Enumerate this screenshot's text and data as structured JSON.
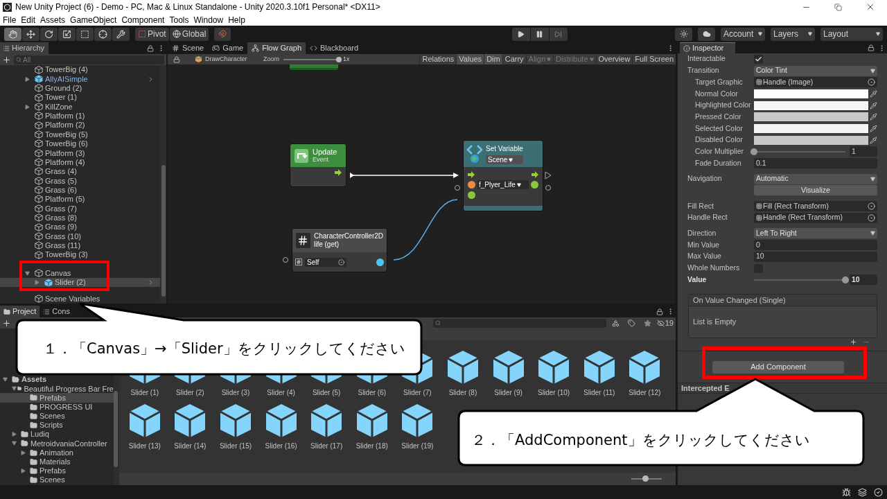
{
  "window": {
    "title": "New Unity Project (6) - Demo - PC, Mac & Linux Standalone - Unity 2020.3.10f1 Personal* <DX11>",
    "menu": [
      "File",
      "Edit",
      "Assets",
      "GameObject",
      "Component",
      "Tools",
      "Window",
      "Help"
    ]
  },
  "toolbar": {
    "tools": [
      {
        "kind": "hand",
        "selected": true
      },
      {
        "kind": "move",
        "selected": false
      },
      {
        "kind": "rotate",
        "selected": false
      },
      {
        "kind": "scale",
        "selected": false
      },
      {
        "kind": "rect",
        "selected": false
      },
      {
        "kind": "transform",
        "selected": false
      },
      {
        "kind": "custom",
        "selected": false
      }
    ],
    "pivot": "Pivot",
    "space": "Global",
    "account": "Account",
    "layers": "Layers",
    "layout": "Layout"
  },
  "hierarchy": {
    "title": "Hierarchy",
    "placeholder": "All",
    "items": [
      {
        "label": "TowerBig (4)",
        "prefab": false,
        "selected": false
      },
      {
        "label": "AllyAISimple",
        "prefab": true,
        "selected": false,
        "expanded": false
      },
      {
        "label": "Ground (2)",
        "prefab": false,
        "selected": false
      },
      {
        "label": "Tower (1)",
        "prefab": false,
        "selected": false
      },
      {
        "label": "KillZone",
        "prefab": false,
        "selected": false,
        "expanded": false
      },
      {
        "label": "Platform (1)",
        "prefab": false,
        "selected": false
      },
      {
        "label": "Platform (2)",
        "prefab": false,
        "selected": false
      },
      {
        "label": "TowerBig (5)",
        "prefab": false,
        "selected": false
      },
      {
        "label": "TowerBig (6)",
        "prefab": false,
        "selected": false
      },
      {
        "label": "Platform (3)",
        "prefab": false,
        "selected": false
      },
      {
        "label": "Platform (4)",
        "prefab": false,
        "selected": false
      },
      {
        "label": "Grass (4)",
        "prefab": false,
        "selected": false
      },
      {
        "label": "Grass (5)",
        "prefab": false,
        "selected": false
      },
      {
        "label": "Grass (6)",
        "prefab": false,
        "selected": false
      },
      {
        "label": "Platform (5)",
        "prefab": false,
        "selected": false
      },
      {
        "label": "Grass (7)",
        "prefab": false,
        "selected": false
      },
      {
        "label": "Grass (8)",
        "prefab": false,
        "selected": false
      },
      {
        "label": "Grass (9)",
        "prefab": false,
        "selected": false
      },
      {
        "label": "Grass (10)",
        "prefab": false,
        "selected": false
      },
      {
        "label": "Grass (11)",
        "prefab": false,
        "selected": false
      },
      {
        "label": "TowerBig (3)",
        "prefab": false,
        "selected": false
      },
      {
        "label": "Canvas",
        "prefab": false,
        "selected": false,
        "expanded": true,
        "children": [
          {
            "label": "Slider (2)",
            "prefab": true,
            "selected": true,
            "expanded": false
          }
        ]
      },
      {
        "label": "Scene Variables",
        "prefab": false,
        "selected": false
      }
    ]
  },
  "graph": {
    "tabs": [
      {
        "label": "Scene",
        "kind": "scene",
        "selected": false
      },
      {
        "label": "Game",
        "kind": "game",
        "selected": false
      },
      {
        "label": "Flow Graph",
        "kind": "flow",
        "selected": true
      },
      {
        "label": "Blackboard",
        "kind": "code",
        "selected": false
      }
    ],
    "asset": "DrawCharacter",
    "zoom_label": "Zoom",
    "zoom": {
      "level": 1
    },
    "zoom_value": "1x",
    "buttons": [
      {
        "label": "Relations",
        "selected": false,
        "disabled": false,
        "kind": "toggle"
      },
      {
        "label": "Values",
        "selected": true,
        "disabled": false,
        "kind": "toggle"
      },
      {
        "label": "Dim",
        "selected": true,
        "disabled": false,
        "kind": "toggle"
      },
      {
        "label": "Carry",
        "selected": false,
        "disabled": false,
        "kind": "toggle"
      },
      {
        "label": "Align",
        "selected": false,
        "disabled": true,
        "kind": "dropdown"
      },
      {
        "label": "Distribute",
        "selected": false,
        "disabled": true,
        "kind": "dropdown"
      },
      {
        "label": "Overview",
        "selected": false,
        "disabled": false,
        "kind": "toggle"
      },
      {
        "label": "Full Screen",
        "selected": false,
        "disabled": false,
        "kind": "toggle"
      }
    ],
    "nodes": [
      {
        "kind": "partial"
      },
      {
        "kind": "event",
        "title": "Update",
        "subtitle": "Event"
      },
      {
        "kind": "set_variable",
        "title": "Set Variable",
        "scope": "Scene",
        "variable": "f_Plyer_Life"
      },
      {
        "kind": "getter",
        "title": "CharacterController2D",
        "subtitle": "life (get)",
        "target": "Self"
      }
    ]
  },
  "project": {
    "tabs": [
      {
        "label": "Project",
        "kind": "folder",
        "selected": true
      },
      {
        "label": "Cons",
        "kind": "console",
        "selected": false
      }
    ],
    "hidden_count": "19",
    "tree": [
      {
        "label": "Assets",
        "expanded": true,
        "selected": false,
        "children": [
          {
            "label": "Beautiful Progress Bar Fre",
            "expanded": true,
            "selected": false,
            "children": [
              {
                "label": "Prefabs",
                "selected": true
              },
              {
                "label": "PROGRESS UI",
                "selected": false
              },
              {
                "label": "Scenes",
                "selected": false
              },
              {
                "label": "Scripts",
                "selected": false
              }
            ]
          },
          {
            "label": "Ludiq",
            "expanded": false,
            "selected": false
          },
          {
            "label": "MetroidvaniaController",
            "expanded": true,
            "selected": false,
            "children": [
              {
                "label": "Animation",
                "expanded": false,
                "selected": false
              },
              {
                "label": "Materials",
                "selected": false
              },
              {
                "label": "Prefabs",
                "expanded": false,
                "selected": false
              },
              {
                "label": "Scenes",
                "selected": false
              }
            ]
          }
        ]
      }
    ],
    "assets": [
      "Slider (1)",
      "Slider (2)",
      "Slider (3)",
      "Slider (4)",
      "Slider (5)",
      "Slider (6)",
      "Slider (7)",
      "Slider (8)",
      "Slider (9)",
      "Slider (10)",
      "Slider (11)",
      "Slider (12)",
      "Slider (13)",
      "Slider (14)",
      "Slider (15)",
      "Slider (16)",
      "Slider (17)",
      "Slider (18)",
      "Slider (19)"
    ],
    "size": {
      "level": 0.45
    }
  },
  "inspector": {
    "title": "Inspector",
    "groups": [
      [
        {
          "kind": "checkbox",
          "label": "Interactable",
          "checked": true
        },
        {
          "kind": "dropdown",
          "label": "Transition",
          "value": "Color Tint",
          "children": [
            {
              "kind": "object",
              "label": "Target Graphic",
              "value": "Handle (Image)"
            },
            {
              "kind": "color",
              "label": "Normal Color",
              "color": "#ffffff"
            },
            {
              "kind": "color",
              "label": "Highlighted Color",
              "color": "#f5f5f5"
            },
            {
              "kind": "color",
              "label": "Pressed Color",
              "color": "#c8c8c8"
            },
            {
              "kind": "color",
              "label": "Selected Color",
              "color": "#f5f5f5"
            },
            {
              "kind": "color",
              "label": "Disabled Color",
              "color": "#c8c8c8"
            },
            {
              "kind": "slider",
              "label": "Color Multiplier",
              "level": 0,
              "value": "1"
            },
            {
              "kind": "field",
              "label": "Fade Duration",
              "value": "0.1"
            }
          ]
        }
      ],
      [
        {
          "kind": "dropdown",
          "label": "Navigation",
          "value": "Automatic"
        },
        {
          "kind": "button",
          "value": "Visualize"
        }
      ],
      [
        {
          "kind": "object",
          "label": "Fill Rect",
          "value": "Fill (Rect Transform)"
        },
        {
          "kind": "object",
          "label": "Handle Rect",
          "value": "Handle (Rect Transform)"
        }
      ],
      [
        {
          "kind": "dropdown",
          "label": "Direction",
          "value": "Left To Right"
        },
        {
          "kind": "field",
          "label": "Min Value",
          "value": "0"
        },
        {
          "kind": "field",
          "label": "Max Value",
          "value": "10"
        },
        {
          "kind": "checkbox",
          "label": "Whole Numbers",
          "checked": false
        },
        {
          "kind": "slider",
          "label": "Value",
          "level": 1,
          "value": "10",
          "bold": true
        }
      ]
    ],
    "event": {
      "title": "On Value Changed (Single)",
      "empty": "List is Empty"
    },
    "add_button": "Add Component",
    "next_panel": "Intercepted E"
  },
  "callouts": [
    "１．「Canvas」→「Slider」をクリックしてください",
    "２．「AddComponent」をクリックしてください"
  ]
}
